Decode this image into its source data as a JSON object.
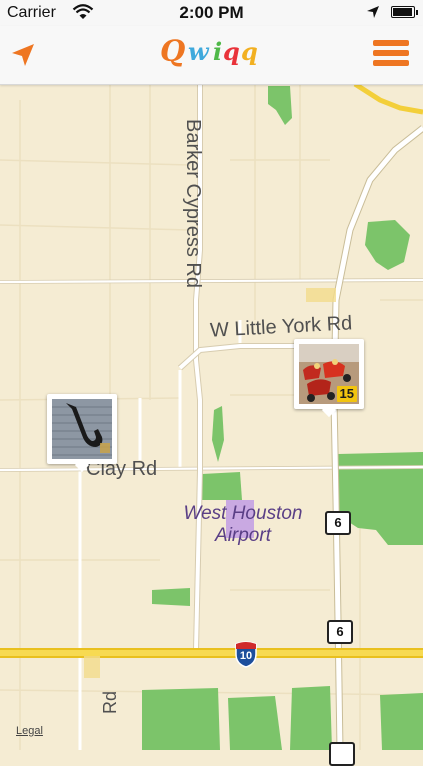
{
  "status_bar": {
    "carrier": "Carrier",
    "time": "2:00 PM",
    "battery_level": 0.95
  },
  "nav_bar": {
    "logo_text": "Qwiqq",
    "icons": {
      "locate": "location-arrow-icon",
      "menu": "hamburger-menu-icon"
    }
  },
  "map": {
    "roads": {
      "barker_cypress": "Barker Cypress Rd",
      "w_little_york": "W Little York Rd",
      "clay": "Clay Rd",
      "bottom_road": "Rd"
    },
    "airport": {
      "line1": "West Houston",
      "line2": "Airport"
    },
    "highway_shields": {
      "hwy6_a": "6",
      "hwy6_b": "6",
      "i10": "10"
    },
    "legal_link": "Legal"
  },
  "pins": [
    {
      "name": "saxophone-listing-pin",
      "count": ""
    },
    {
      "name": "go-kart-listing-pin",
      "count": "15"
    }
  ],
  "colors": {
    "accent_orange": "#ee7622",
    "map_land": "#f5ecd3",
    "park_green": "#7cc46a",
    "highway_yellow": "#f3cf3a",
    "airport_purple": "#c9a9e2"
  }
}
